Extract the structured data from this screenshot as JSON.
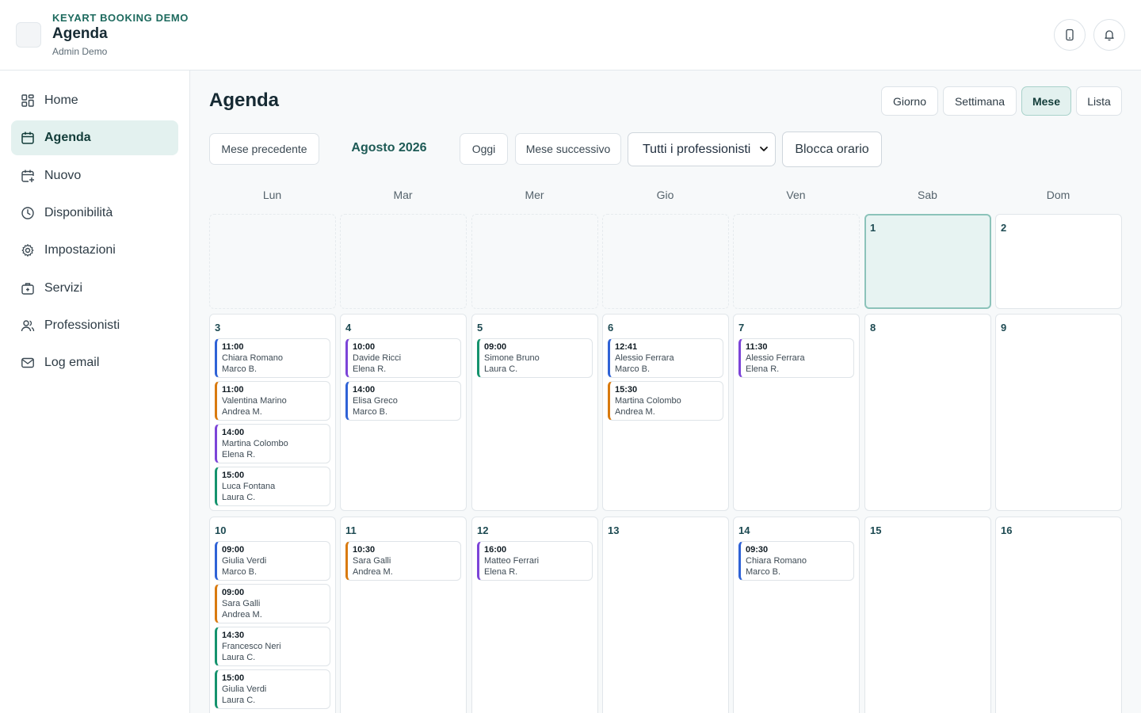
{
  "header": {
    "brand": "KEYART BOOKING DEMO",
    "title": "Agenda",
    "user": "Admin Demo",
    "icons": [
      "phone-icon",
      "bell-icon"
    ]
  },
  "sidebar": {
    "items": [
      {
        "label": "Home",
        "icon": "grid-icon"
      },
      {
        "label": "Agenda",
        "icon": "calendar-icon",
        "active": true
      },
      {
        "label": "Nuovo",
        "icon": "calendar-plus-icon"
      },
      {
        "label": "Disponibilità",
        "icon": "clock-icon"
      },
      {
        "label": "Impostazioni",
        "icon": "gear-icon"
      },
      {
        "label": "Servizi",
        "icon": "briefcase-icon"
      },
      {
        "label": "Professionisti",
        "icon": "users-icon"
      },
      {
        "label": "Log email",
        "icon": "mail-icon"
      }
    ]
  },
  "main": {
    "title": "Agenda",
    "views": [
      "Giorno",
      "Settimana",
      "Mese",
      "Lista"
    ],
    "active_view": "Mese",
    "prev": "Mese precedente",
    "month": "Agosto 2026",
    "today": "Oggi",
    "next": "Mese successivo",
    "filter": "Tutti i professionisti",
    "block": "Blocca orario"
  },
  "calendar": {
    "weekdays": [
      "Lun",
      "Mar",
      "Mer",
      "Gio",
      "Ven",
      "Sab",
      "Dom"
    ],
    "weeks": [
      [
        null,
        null,
        null,
        null,
        null,
        {
          "day": "1",
          "today": true,
          "appts": []
        },
        {
          "day": "2",
          "appts": []
        }
      ],
      [
        {
          "day": "3",
          "appts": [
            {
              "time": "11:00",
              "client": "Chiara Romano",
              "pro": "Marco B."
            },
            {
              "time": "11:00",
              "client": "Valentina Marino",
              "pro": "Andrea M."
            },
            {
              "time": "14:00",
              "client": "Martina Colombo",
              "pro": "Elena R."
            },
            {
              "time": "15:00",
              "client": "Luca Fontana",
              "pro": "Laura C."
            }
          ]
        },
        {
          "day": "4",
          "appts": [
            {
              "time": "10:00",
              "client": "Davide Ricci",
              "pro": "Elena R."
            },
            {
              "time": "14:00",
              "client": "Elisa Greco",
              "pro": "Marco B."
            }
          ]
        },
        {
          "day": "5",
          "appts": [
            {
              "time": "09:00",
              "client": "Simone Bruno",
              "pro": "Laura C."
            }
          ]
        },
        {
          "day": "6",
          "appts": [
            {
              "time": "12:41",
              "client": "Alessio Ferrara",
              "pro": "Marco B."
            },
            {
              "time": "15:30",
              "client": "Martina Colombo",
              "pro": "Andrea M."
            }
          ]
        },
        {
          "day": "7",
          "appts": [
            {
              "time": "11:30",
              "client": "Alessio Ferrara",
              "pro": "Elena R."
            }
          ]
        },
        {
          "day": "8",
          "appts": []
        },
        {
          "day": "9",
          "appts": []
        }
      ],
      [
        {
          "day": "10",
          "appts": [
            {
              "time": "09:00",
              "client": "Giulia Verdi",
              "pro": "Marco B."
            },
            {
              "time": "09:00",
              "client": "Sara Galli",
              "pro": "Andrea M."
            },
            {
              "time": "14:30",
              "client": "Francesco Neri",
              "pro": "Laura C."
            },
            {
              "time": "15:00",
              "client": "Giulia Verdi",
              "pro": "Laura C."
            }
          ]
        },
        {
          "day": "11",
          "appts": [
            {
              "time": "10:30",
              "client": "Sara Galli",
              "pro": "Andrea M."
            }
          ]
        },
        {
          "day": "12",
          "appts": [
            {
              "time": "16:00",
              "client": "Matteo Ferrari",
              "pro": "Elena R."
            }
          ]
        },
        {
          "day": "13",
          "appts": []
        },
        {
          "day": "14",
          "appts": [
            {
              "time": "09:30",
              "client": "Chiara Romano",
              "pro": "Marco B."
            }
          ]
        },
        {
          "day": "15",
          "appts": []
        },
        {
          "day": "16",
          "appts": []
        }
      ]
    ]
  },
  "pro_colors": {
    "Marco B.": "#2f62d6",
    "Andrea M.": "#d97a0f",
    "Elena R.": "#7c44d8",
    "Laura C.": "#15936d"
  }
}
